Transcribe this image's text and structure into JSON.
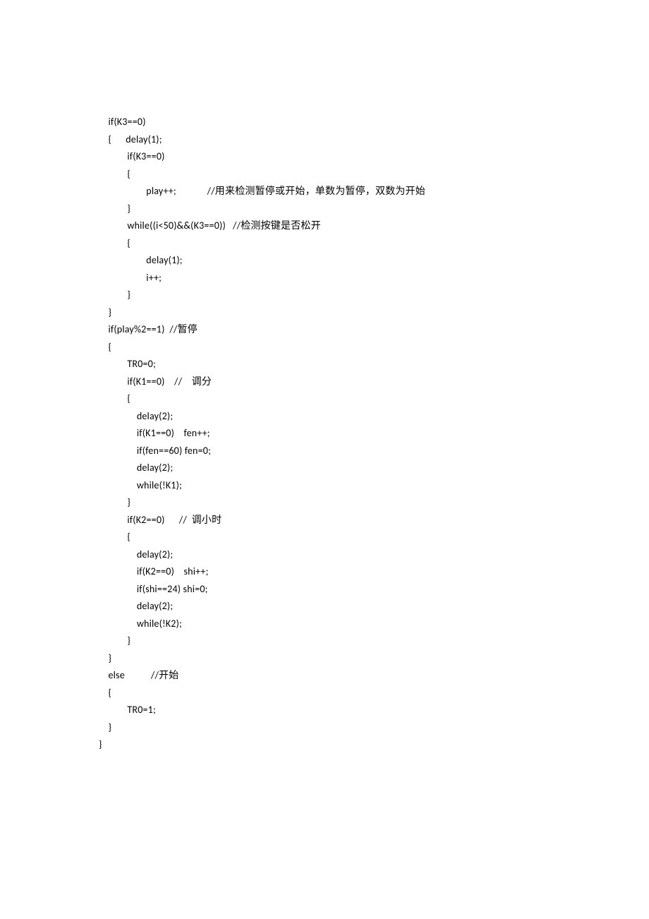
{
  "code": {
    "lines": [
      "    if(K3==0)",
      "    {      delay(1);",
      "            if(K3==0)",
      "            {",
      "                    play++;             //用来检测暂停或开始，单数为暂停，双数为开始",
      "            }",
      "            while((i<50)&&(K3==0))   //检测按键是否松开",
      "            {",
      "                    delay(1);",
      "                    i++;",
      "            }",
      "    }",
      "    if(play%2==1)  //暂停",
      "    {",
      "            TR0=0;",
      "            if(K1==0)    //    调分",
      "            {",
      "                delay(2);",
      "                if(K1==0)    fen++;",
      "                if(fen==60) fen=0;",
      "                delay(2);",
      "                while(!K1);",
      "            }",
      "            if(K2==0)      //  调小时",
      "            {",
      "                delay(2);",
      "                if(K2==0)    shi++;",
      "                if(shi==24) shi=0;",
      "                delay(2);",
      "                while(!K2);",
      "            }",
      "    }",
      "    else           //开始",
      "    {",
      "            TR0=1;",
      "    }",
      "}"
    ]
  }
}
